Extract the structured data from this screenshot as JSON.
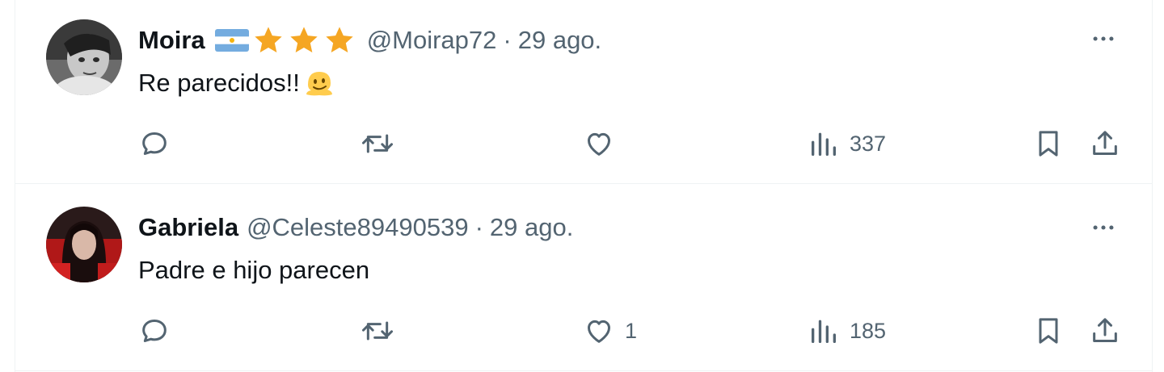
{
  "tweets": [
    {
      "author_name": "Moira",
      "has_flag": true,
      "stars": 3,
      "handle": "@Moirap72",
      "separator": "·",
      "date": "29 ago.",
      "text": "Re parecidos!!",
      "emoji": "melting-face-emoji",
      "reply_count": "",
      "retweet_count": "",
      "like_count": "",
      "view_count": "337"
    },
    {
      "author_name": "Gabriela",
      "has_flag": false,
      "stars": 0,
      "handle": "@Celeste89490539",
      "separator": "·",
      "date": "29 ago.",
      "text": "Padre e hijo parecen",
      "reply_count": "",
      "retweet_count": "",
      "like_count": "1",
      "view_count": "185"
    }
  ],
  "icons": {
    "reply": "reply-icon",
    "retweet": "retweet-icon",
    "like": "heart-icon",
    "views": "views-icon",
    "bookmark": "bookmark-icon",
    "share": "share-icon",
    "more": "more-icon"
  },
  "colors": {
    "text": "#0f1419",
    "secondary": "#536471",
    "star": "#f5a623",
    "border": "#eff3f4"
  }
}
